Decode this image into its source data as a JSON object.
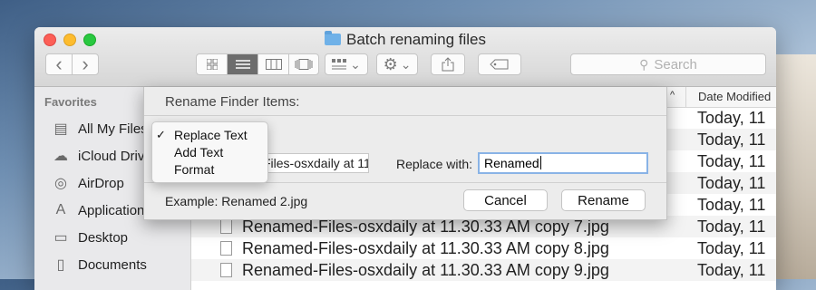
{
  "window": {
    "title": "Batch renaming files"
  },
  "toolbar": {
    "back_glyph": "‹",
    "forward_glyph": "›",
    "view_icon": "icon-view-glyph",
    "list_icon": "list-view-glyph",
    "column_icon": "column-view-glyph",
    "cover_icon": "cover-flow-glyph",
    "arrange_icon": "arrange-glyph",
    "action_icon": "gear-glyph",
    "share_icon": "share-glyph",
    "tag_icon": "tag-glyph",
    "dropdown_glyph": "⌄",
    "search_placeholder": "Search"
  },
  "sidebar": {
    "heading": "Favorites",
    "items": [
      {
        "label": "All My Files",
        "icon": "all-files-icon"
      },
      {
        "label": "iCloud Drive",
        "icon": "cloud-icon"
      },
      {
        "label": "AirDrop",
        "icon": "airdrop-icon"
      },
      {
        "label": "Applications",
        "icon": "applications-icon"
      },
      {
        "label": "Desktop",
        "icon": "desktop-icon"
      },
      {
        "label": "Documents",
        "icon": "documents-icon"
      }
    ]
  },
  "filelist": {
    "sort_indicator": "^",
    "date_header": "Date Modified",
    "rows": [
      {
        "name": "",
        "date": "Today, 11"
      },
      {
        "name": "",
        "date": "Today, 11"
      },
      {
        "name": "",
        "date": "Today, 11"
      },
      {
        "name": "",
        "date": "Today, 11"
      },
      {
        "name": "",
        "date": "Today, 11"
      },
      {
        "name": "Renamed-Files-osxdaily at 11.30.33 AM copy 7.jpg",
        "date": "Today, 11"
      },
      {
        "name": "Renamed-Files-osxdaily at 11.30.33 AM copy 8.jpg",
        "date": "Today, 11"
      },
      {
        "name": "Renamed-Files-osxdaily at 11.30.33 AM copy 9.jpg",
        "date": "Today, 11"
      }
    ]
  },
  "dialog": {
    "title": "Rename Finder Items:",
    "find_value": "Files-osxdaily at 11",
    "replace_label": "Replace with:",
    "replace_value": "Renamed",
    "example": "Example: Renamed 2.jpg",
    "cancel_label": "Cancel",
    "rename_label": "Rename",
    "menu": {
      "check": "✓",
      "items": [
        "Replace Text",
        "Add Text",
        "Format"
      ],
      "selected": "Replace Text"
    }
  }
}
